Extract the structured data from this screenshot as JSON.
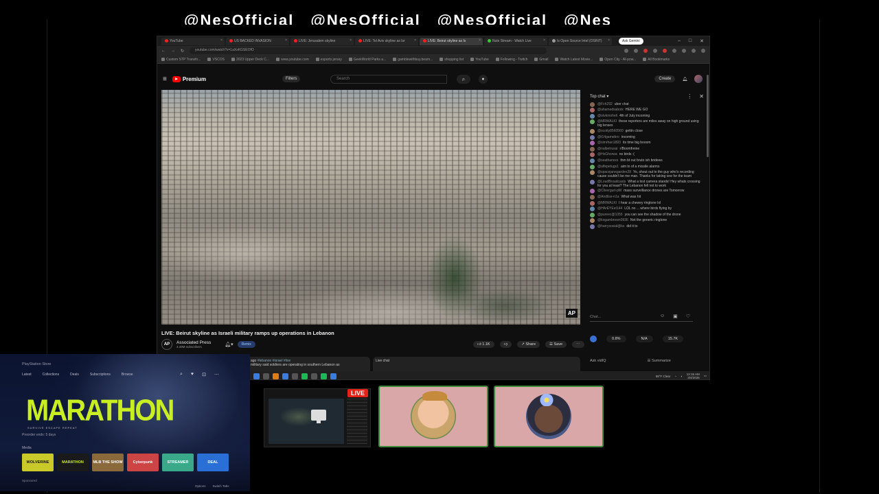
{
  "banner_text": [
    "@NesOfficial",
    "@NesOfficial",
    "@NesOfficial",
    "@Nes"
  ],
  "browser": {
    "tabs": [
      {
        "label": "YouTube"
      },
      {
        "label": "US BACKED INVASION"
      },
      {
        "label": "LIVE: Jerusalem skyline"
      },
      {
        "label": "LIVE: Tel Aviv skyline as Isr"
      },
      {
        "label": "LIVE: Beirut skyline as Is",
        "active": true
      },
      {
        "label": "Nuts Stream - Watch Live"
      },
      {
        "label": "Is Open Source Intel (OSINT)"
      }
    ],
    "ask_label": "Ask Gemini",
    "url": "youtube.com/watch?v=1aXsKGSEOfO",
    "bookmarks": [
      "Custom STP Transfo...",
      "VSCOS",
      "2023 Upper Deck C...",
      "www.youtube.com",
      "esports jersey",
      "GeekWorld Parks a...",
      "gamblewithbuy.beam...",
      "shopping list",
      "YouTube",
      "Following - Twitch",
      "Gmail",
      "Watch Latest Movie...",
      "Open City - AI-pow...",
      "All Bookmarks"
    ]
  },
  "youtube": {
    "brand": "Premium",
    "filters_label": "Filters",
    "search_placeholder": "Search",
    "create_label": "Create",
    "ap_badge": "AP",
    "video_title": "LIVE: Beirut skyline as Israeli military ramps up operations in Lebanon",
    "channel_name": "Associated Press",
    "channel_subs": "4.49M subscribers",
    "channel_logo": "AP",
    "remix_label": "Remix",
    "likes": "1.1K",
    "share_label": "Share",
    "save_label": "Save",
    "desc_text": "#lebanon #israel #live",
    "desc_text2": "military said soldiers are operating in southern Lebanon as",
    "live_chat_label": "Live chat",
    "desc_prefix": "ago"
  },
  "chat": {
    "header": "Top chat",
    "messages": [
      {
        "user": "@Fch292",
        "text": "uber chat"
      },
      {
        "user": "@ahamedsabotx",
        "text": "HERE WE GO"
      },
      {
        "user": "@otvkmoheli",
        "text": "4th of July incoming"
      },
      {
        "user": "@MRWALKI",
        "text": "these reporters are miles away on high ground using big lenses"
      },
      {
        "user": "@scotty8560560",
        "text": "gettin close"
      },
      {
        "user": "@t14gamebro",
        "text": "incoming"
      },
      {
        "user": "@simrhan1893",
        "text": "its time big booom"
      },
      {
        "user": "@nalbetrusai",
        "text": "r/Boomfreine"
      },
      {
        "user": "@HsGhorwa",
        "text": "no birds :("
      },
      {
        "user": "@seathanxxx",
        "text": "thm bt out bruto ish bridews"
      },
      {
        "user": "@alfepetugs1",
        "text": "aim to of a missile alarms"
      },
      {
        "user": "@spacejanegarden28",
        "text": "Yo, shout out to the guy who's recording cause couldn't be me man. Thanks for taking one for the team"
      },
      {
        "user": "@LoudBroadcasts",
        "text": "What a lost camera stands! Hey whats crossing for you at least? The Lebanon fell not to work"
      },
      {
        "user": "@Clivergurt-pM",
        "text": "mass surveillance drones are Tomorrow"
      },
      {
        "user": "@Andlise-n1a",
        "text": "What was hit"
      },
      {
        "user": "@MRWALKI",
        "text": "I hear a chewey ringtone lol"
      },
      {
        "user": "@HArEYEet144",
        "text": "LOL no ... where birds flying by"
      },
      {
        "user": "@pureec@1055",
        "text": "you can see the shadow of the drone"
      },
      {
        "user": "@kogambrown0936",
        "text": "Not the generic ringtone"
      },
      {
        "user": "@harryxocial@ks",
        "text": "did it to"
      }
    ],
    "input_placeholder": "Chat...",
    "poll": [
      "0.8%",
      "N/A",
      "15.7K"
    ],
    "ask_label": "Ask vidIQ",
    "summarize_label": "Summarize"
  },
  "taskbar": {
    "weather": "58°F Clear",
    "time": "12:15 AM",
    "date": "3/4/2026"
  },
  "playstation": {
    "brand": "PlayStation Store",
    "nav": [
      "Latest",
      "Collections",
      "Deals",
      "Subscriptions",
      "Browse"
    ],
    "game_title": "MARATHON",
    "game_tagline": "SURVIVE   ESCAPE   REPEAT",
    "play_time": "Preorder ends: 5 days",
    "media_label": "Media",
    "tiles": [
      {
        "label": "WOLVERINE",
        "color": "#c9c92a"
      },
      {
        "label": "MARATHON",
        "color": "#1a1a1a"
      },
      {
        "label": "MLB THE SHOW",
        "color": "#8a6a3a"
      },
      {
        "label": "Cyberpunk",
        "color": "#c44"
      },
      {
        "label": "STREAMER",
        "color": "#3aa98a"
      },
      {
        "label": "DEAL",
        "color": "#2a6fd6"
      }
    ],
    "sponsored": "Sponsored",
    "footer": [
      "Options",
      "Switch Tabs"
    ]
  },
  "live_badge": "LIVE",
  "colors": {
    "accent_red": "#ff0000",
    "cam_border": "#3b8b3b",
    "game_yellow": "#c9ef22"
  }
}
